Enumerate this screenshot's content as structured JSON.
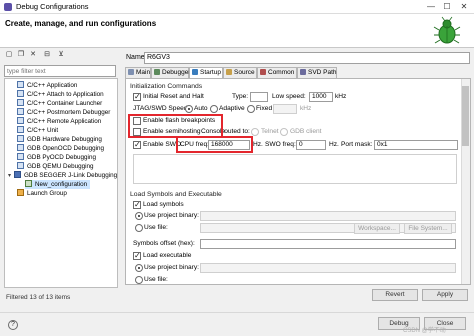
{
  "window": {
    "title": "Debug Configurations",
    "minimize": "—",
    "maximize": "☐",
    "close": "✕"
  },
  "header": {
    "title": "Create, manage, and run configurations"
  },
  "toolbar": {
    "icons": [
      "new-config-icon",
      "duplicate-icon",
      "delete-icon",
      "collapse-icon",
      "filter-icon"
    ]
  },
  "filter": {
    "placeholder": "type filter text"
  },
  "tree": [
    {
      "label": "C/C++ Application",
      "icon": "c"
    },
    {
      "label": "C/C++ Attach to Application",
      "icon": "c"
    },
    {
      "label": "C/C++ Container Launcher",
      "icon": "c"
    },
    {
      "label": "C/C++ Postmortem Debugger",
      "icon": "c"
    },
    {
      "label": "C/C++ Remote Application",
      "icon": "c"
    },
    {
      "label": "C/C++ Unit",
      "icon": "c"
    },
    {
      "label": "GDB Hardware Debugging",
      "icon": "c"
    },
    {
      "label": "GDB OpenOCD Debugging",
      "icon": "c"
    },
    {
      "label": "GDB PyOCD Debugging",
      "icon": "c"
    },
    {
      "label": "GDB QEMU Debugging",
      "icon": "c"
    },
    {
      "label": "GDB SEGGER J-Link Debugging",
      "icon": "g"
    },
    {
      "label": "New_configuration",
      "icon": "cfg"
    },
    {
      "label": "Launch Group",
      "icon": "launch"
    }
  ],
  "status": {
    "filtered": "Filtered 13 of 13 items"
  },
  "config": {
    "name_label": "Name:",
    "name_value": "R6GV3"
  },
  "tabs": [
    {
      "label": "Main",
      "active": false
    },
    {
      "label": "Debugger",
      "active": false
    },
    {
      "label": "Startup",
      "active": true
    },
    {
      "label": "Source",
      "active": false
    },
    {
      "label": "Common",
      "active": false
    },
    {
      "label": "SVD Path",
      "active": false
    }
  ],
  "init": {
    "group": "Initialization Commands",
    "reset_halt": "Initial Reset and Halt",
    "type_label": "Type:",
    "type_value": "",
    "low_speed_label": "Low speed:",
    "low_speed_value": "1000",
    "khz1": "kHz",
    "jtag_label": "JTAG/SWD Speed:",
    "auto": "Auto",
    "adaptive": "Adaptive",
    "fixed": "Fixed",
    "fixed_value": "",
    "khz2": "kHz",
    "flash_bp": "Enable flash breakpoints",
    "semihost": "Enable semihosting",
    "console": "Console",
    "routed_to": "routed to:",
    "telnet": "Telnet",
    "gdb_client": "GDB client",
    "enable_swo": "Enable SWO",
    "cpu_freq_label": "CPU freq:",
    "cpu_freq_value": "168000",
    "hz1": "Hz.",
    "swo_freq_label": "SWO freq:",
    "swo_freq_value": "0",
    "hz2": "Hz.",
    "port_mask_label": "Port mask:",
    "port_mask_value": "0x1"
  },
  "load": {
    "group": "Load Symbols and Executable",
    "load_symbols": "Load symbols",
    "use_project_binary": "Use project binary:",
    "use_file": "Use file:",
    "workspace": "Workspace...",
    "file_system": "File System...",
    "symbols_offset": "Symbols offset (hex):",
    "load_exec": "Load executable",
    "use_project_binary2": "Use project binary:",
    "use_file2": "Use file:"
  },
  "buttons": {
    "revert": "Revert",
    "apply": "Apply",
    "debug": "Debug",
    "close": "Close"
  },
  "watermark": "CSDN @学不动"
}
